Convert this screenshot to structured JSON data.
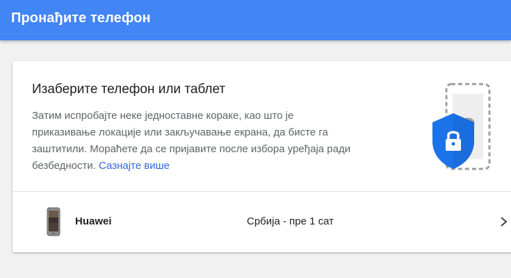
{
  "header": {
    "title": "Пронађите телефон"
  },
  "card": {
    "heading": "Изаберите телефон или таблет",
    "description": "Затим испробајте неке једноставне кораке, као што је приказивање локације или закључавање екрана, да бисте га заштитили. Мораћете да се пријавите после избора уређаја ради безбедности.",
    "learn_more": "Сазнајте више",
    "illustration_icons": [
      "phone-question-icon",
      "lock-shield-icon"
    ]
  },
  "devices": [
    {
      "name": "Huawei",
      "status": "Србија - пре 1 сат",
      "icon": "phone-thumbnail-icon"
    }
  ],
  "colors": {
    "header_bg": "#4285f4",
    "shield": "#1a73e8",
    "link": "#3367d6",
    "page_bg": "#f1f1f1"
  }
}
